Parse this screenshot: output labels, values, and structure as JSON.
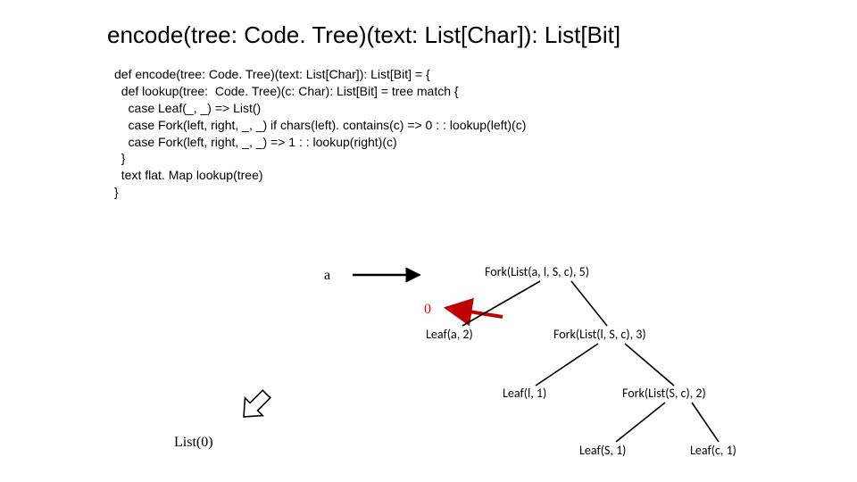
{
  "title": "encode(tree: Code. Tree)(text: List[Char]): List[Bit]",
  "code": {
    "l1": "def encode(tree: Code. Tree)(text: List[Char]): List[Bit] = {",
    "l2": "  def lookup(tree:  Code. Tree)(c: Char): List[Bit] = tree match {",
    "l3": "    case Leaf(_, _) => List()",
    "l4": "    case Fork(left, right, _, _) if chars(left). contains(c) => 0 : : lookup(left)(c)",
    "l5": "    case Fork(left, right, _, _) => 1 : : lookup(right)(c)",
    "l6": "  }",
    "l7": "  text flat. Map lookup(tree)",
    "l8": "}"
  },
  "labels": {
    "a": "a",
    "zero": "0",
    "result": "List(0)"
  },
  "tree": {
    "root": "Fork(List(a, l, S, c), 5)",
    "n1": "Leaf(a, 2)",
    "n2": "Fork(List(l, S, c), 3)",
    "n3": "Leaf(l, 1)",
    "n4": "Fork(List(S, c), 2)",
    "n5": "Leaf(S, 1)",
    "n6": "Leaf(c, 1)"
  }
}
